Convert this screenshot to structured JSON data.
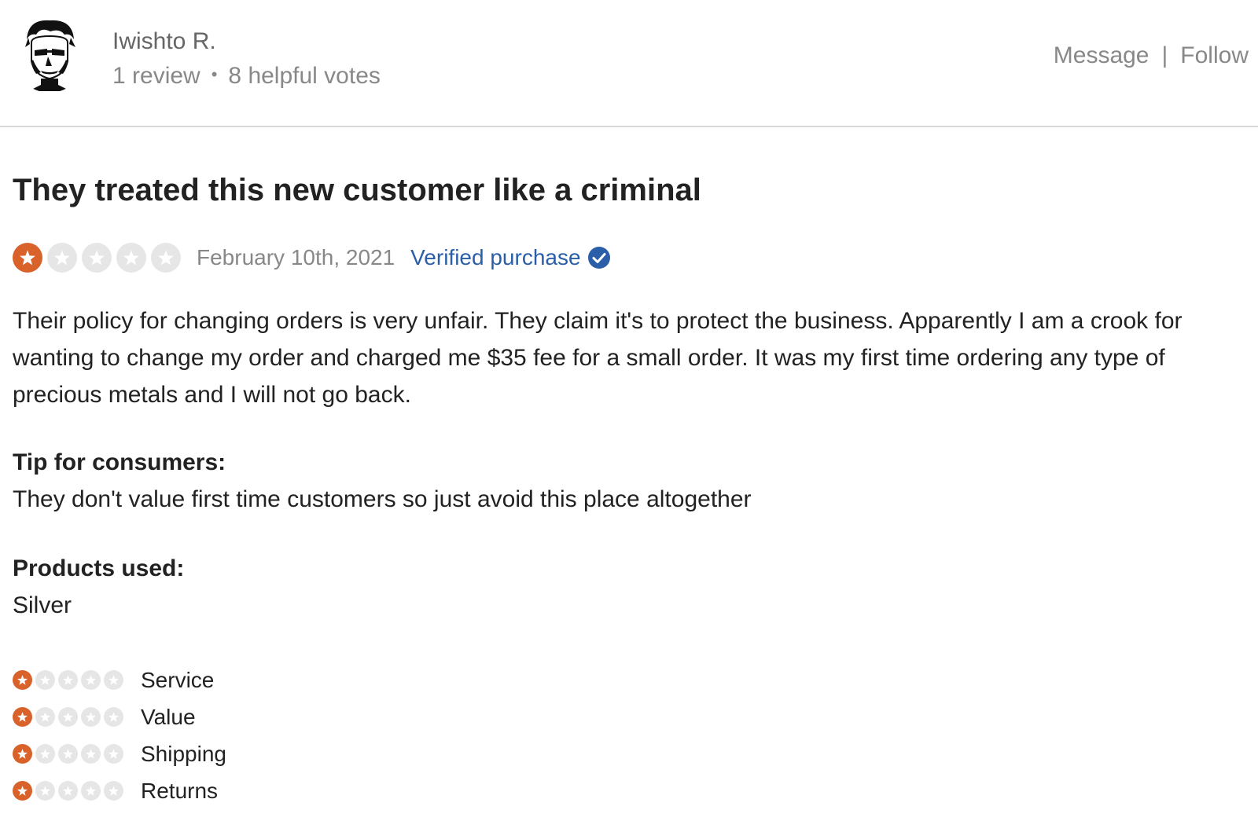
{
  "reviewer": {
    "name": "Iwishto R.",
    "review_count": "1 review",
    "separator": "•",
    "helpful_votes": "8 helpful votes"
  },
  "actions": {
    "message": "Message",
    "divider": "|",
    "follow": "Follow"
  },
  "review": {
    "title": "They treated this new customer like a criminal",
    "rating": 1,
    "max_rating": 5,
    "date": "February 10th, 2021",
    "verified_label": "Verified purchase",
    "body": "Their policy for changing orders is very unfair. They claim it's to protect the business. Apparently I am a crook for wanting to change my order and charged me $35 fee for a small order. It was my first time ordering any type of precious metals and I will not go back.",
    "tip_label": "Tip for consumers:",
    "tip_text": "They don't value first time customers so just avoid this place altogether",
    "products_label": "Products used:",
    "products_text": "Silver",
    "sub_ratings": [
      {
        "label": "Service",
        "rating": 1
      },
      {
        "label": "Value",
        "rating": 1
      },
      {
        "label": "Shipping",
        "rating": 1
      },
      {
        "label": "Returns",
        "rating": 1
      }
    ]
  },
  "colors": {
    "star_filled": "#d9622b",
    "star_empty": "#e6e6e6",
    "verified_blue": "#2a5ea8",
    "icon_names": [
      "star-filled-icon",
      "star-empty-icon",
      "verified-check-icon"
    ]
  }
}
